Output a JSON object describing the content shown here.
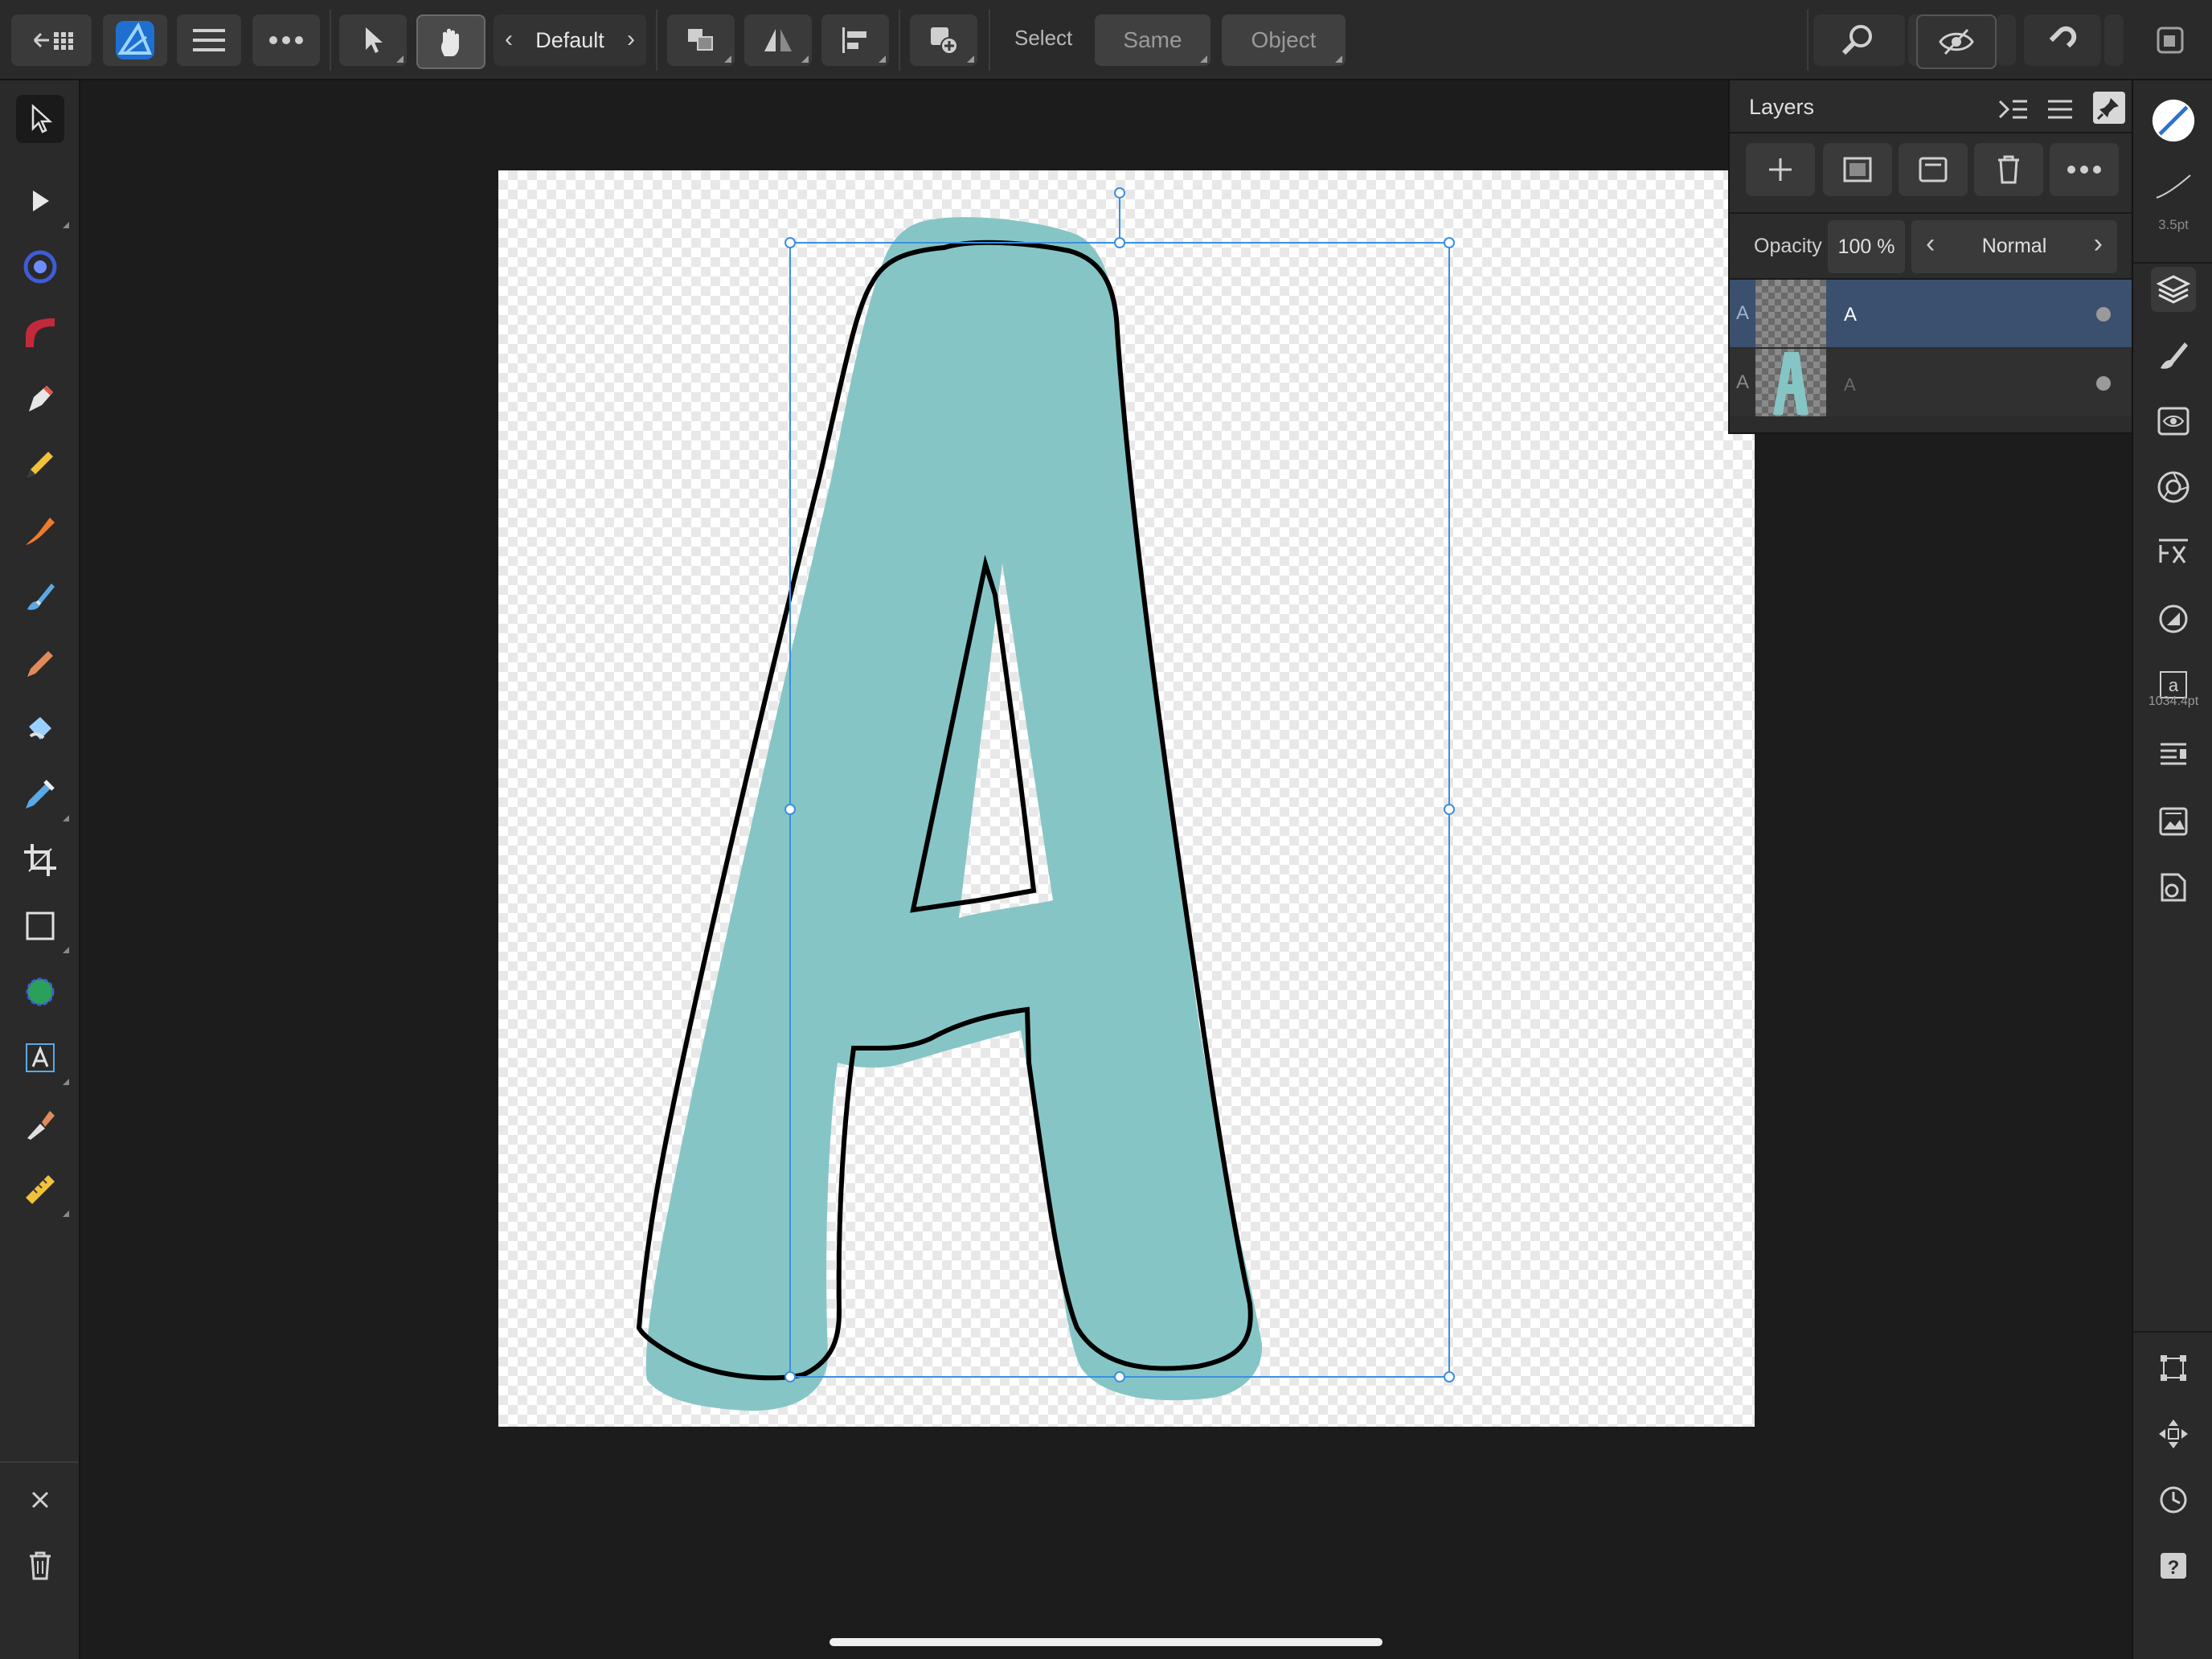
{
  "topbar": {
    "persona_label": "Default",
    "select_label": "Select",
    "same_label": "Same",
    "object_label": "Object"
  },
  "layers_panel": {
    "title": "Layers",
    "opacity_label": "Opacity",
    "opacity_value": "100 %",
    "blend_mode": "Normal",
    "layers": [
      {
        "type_letter": "A",
        "name": "A",
        "selected": true
      },
      {
        "type_letter": "A",
        "name": "A",
        "selected": false
      }
    ]
  },
  "right_studio": {
    "stroke_width": "3.5pt",
    "font_size": "1034.4pt"
  },
  "colors": {
    "accent": "#3a8fe0",
    "selected_layer": "#3a506e",
    "letter_fill": "#86c5c6"
  },
  "icons": {
    "top": [
      "back-grid-icon",
      "app-logo-icon",
      "menu-icon",
      "more-icon",
      "move-tool-icon",
      "gesture-icon",
      "arrange-icon",
      "flip-icon",
      "align-icon",
      "insert-icon",
      "zoom-icon",
      "view-mode-icon",
      "snapping-icon",
      "window-icon"
    ],
    "left": [
      "move-tool-icon",
      "node-tool-icon",
      "gradient-tool-icon",
      "fill-tool-icon",
      "pen-tool-icon",
      "pencil-tool-icon",
      "vector-brush-icon",
      "paint-brush-icon",
      "pixel-brush-icon",
      "erase-brush-icon",
      "color-picker-icon",
      "crop-tool-icon",
      "rectangle-tool-icon",
      "shape-builder-icon",
      "text-tool-icon",
      "eyedropper-icon",
      "ruler-icon",
      "close-icon",
      "trash-icon"
    ]
  }
}
